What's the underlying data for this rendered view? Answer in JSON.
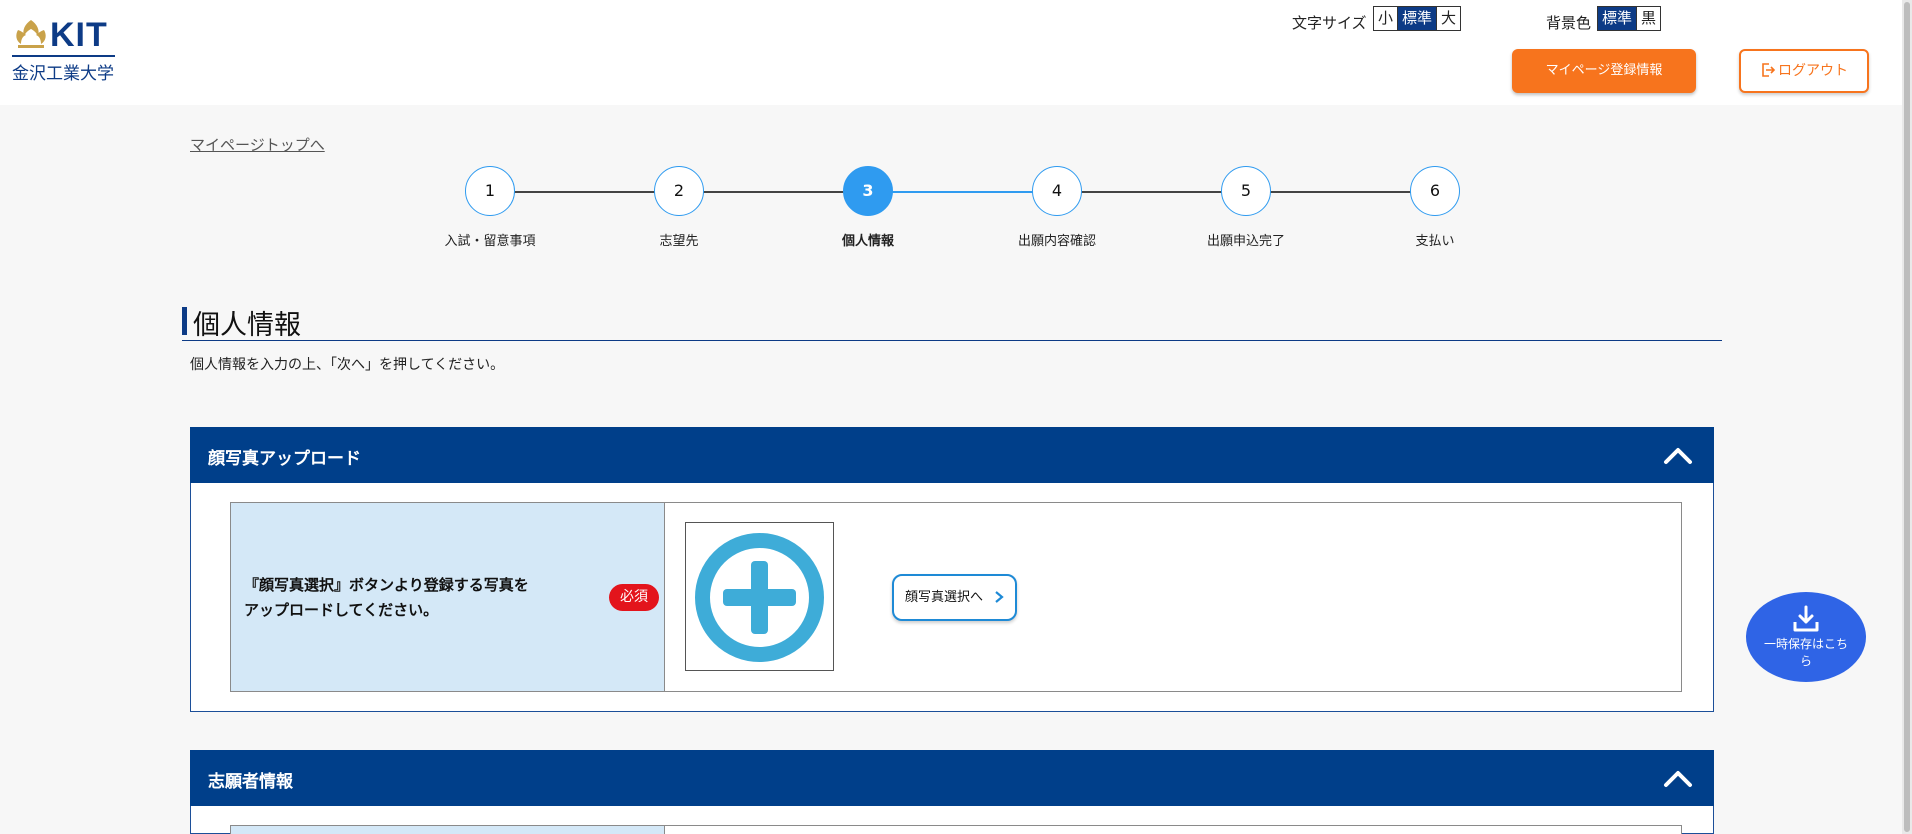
{
  "header": {
    "logo_text": "KIT",
    "logo_subtitle": "金沢工業大学",
    "font_size_label": "文字サイズ",
    "font_size_options": [
      "小",
      "標準",
      "大"
    ],
    "font_size_selected": "標準",
    "bg_color_label": "背景色",
    "bg_color_options": [
      "標準",
      "黒"
    ],
    "bg_color_selected": "標準",
    "mypage_button": "マイページ登録情報",
    "logout_button": "ログアウト"
  },
  "nav": {
    "back_link": "マイページトップへ"
  },
  "stepper": {
    "current_step": 3,
    "steps": [
      {
        "number": "1",
        "label": "入試・留意事項"
      },
      {
        "number": "2",
        "label": "志望先"
      },
      {
        "number": "3",
        "label": "個人情報"
      },
      {
        "number": "4",
        "label": "出願内容確認"
      },
      {
        "number": "5",
        "label": "出願申込完了"
      },
      {
        "number": "6",
        "label": "支払い"
      }
    ]
  },
  "page": {
    "title": "個人情報",
    "intro": "個人情報を入力の上、「次へ」を押してください。"
  },
  "sections": {
    "photo": {
      "title": "顔写真アップロード",
      "instruction_line1": "『顔写真選択』ボタンより登録する写真を",
      "instruction_line2": "アップロードしてください。",
      "required_badge": "必須",
      "select_button": "顔写真選択へ"
    },
    "applicant": {
      "title": "志願者情報"
    }
  },
  "float_save": {
    "label": "一時保存はこちら"
  },
  "colors": {
    "brand_navy": "#003f8a",
    "accent_orange": "#f7741d",
    "step_blue": "#2f9bf0",
    "required_red": "#e3141c",
    "label_bg": "#d4e8f7",
    "save_blue": "#2f64e6"
  },
  "icons": {
    "logo": "kit-logo-icon",
    "logout": "logout-icon",
    "collapse": "chevron-up-icon",
    "photo_placeholder": "plus-circle-icon",
    "select_arrow": "chevron-right-icon",
    "save": "download-icon"
  }
}
